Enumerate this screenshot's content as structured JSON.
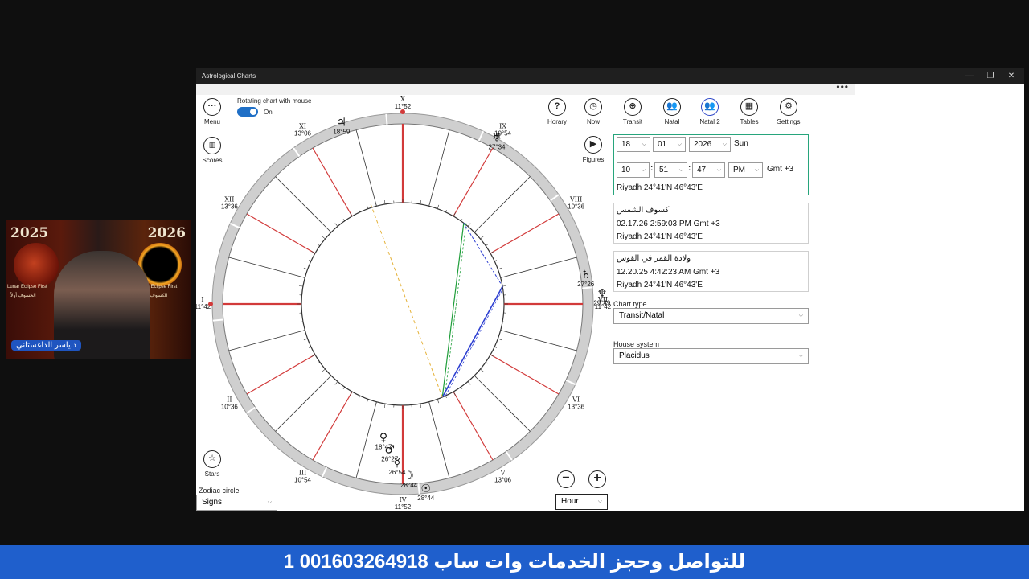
{
  "window": {
    "title": "Astrological Charts",
    "more": "•••",
    "minimize": "—",
    "restore": "❐",
    "close": "✕"
  },
  "left_toolbar": {
    "menu": "Menu",
    "scores": "Scores",
    "stars": "Stars",
    "rotating_label": "Rotating chart with mouse",
    "rotating_state": "On",
    "zodiac_circle_label": "Zodiac circle",
    "zodiac_circle_value": "Signs"
  },
  "top_toolbar": {
    "horary": "Horary",
    "now": "Now",
    "transit": "Transit",
    "natal": "Natal",
    "natal2": "Natal 2",
    "tables": "Tables",
    "settings": "Settings",
    "figures": "Figures"
  },
  "datetime": {
    "day": "18",
    "month": "01",
    "year": "2026",
    "weekday": "Sun",
    "hour": "10",
    "minute": "51",
    "second": "47",
    "ampm": "PM",
    "gmt": "Gmt +3",
    "location": "Riyadh  24°41'N  46°43'E"
  },
  "event1": {
    "title": "كسوف الشمس",
    "datetime": "02.17.26 2:59:03 PM  Gmt +3",
    "location": "Riyadh  24°41'N  46°43'E"
  },
  "event2": {
    "title": "ولادة القمر في القوس",
    "datetime": "12.20.25 4:42:23 AM  Gmt +3",
    "location": "Riyadh  24°41'N  46°43'E"
  },
  "chart_type": {
    "label": "Chart type",
    "value": "Transit/Natal"
  },
  "house_system": {
    "label": "House system",
    "value": "Placidus"
  },
  "step": {
    "minus": "−",
    "plus": "+",
    "unit": "Hour"
  },
  "chart": {
    "houses": [
      {
        "num": "X",
        "deg": "11°52"
      },
      {
        "num": "XI",
        "deg": "13°06"
      },
      {
        "num": "XII",
        "deg": "13°36"
      },
      {
        "num": "I",
        "deg": "11°42"
      },
      {
        "num": "II",
        "deg": "10°36"
      },
      {
        "num": "III",
        "deg": "10°54"
      },
      {
        "num": "IV",
        "deg": "11°52"
      },
      {
        "num": "V",
        "deg": "13°06"
      },
      {
        "num": "VI",
        "deg": "13°36"
      },
      {
        "num": "VII",
        "deg": "11°42"
      },
      {
        "num": "VIII",
        "deg": "10°36"
      },
      {
        "num": "IX",
        "deg": "10°54"
      }
    ],
    "planets": [
      {
        "glyph": "♃",
        "deg": "18°59"
      },
      {
        "glyph": "♅",
        "deg": "27°34"
      },
      {
        "glyph": "♄",
        "deg": "27°26"
      },
      {
        "glyph": "♆",
        "deg": "29°49"
      },
      {
        "glyph": "☉",
        "deg": "28°44"
      },
      {
        "glyph": "☽",
        "deg": "28°44"
      },
      {
        "glyph": "☿",
        "deg": "26°54"
      },
      {
        "glyph": "♂",
        "deg": "26°27"
      },
      {
        "glyph": "♀",
        "deg": "18°47"
      }
    ],
    "retro": "R"
  },
  "webcam": {
    "year_left": "2025",
    "year_right": "2026",
    "caption_left": "Lunar Eclipse First",
    "caption_left_ar": "الخسوف أولاً",
    "caption_right": "Solar Eclipse First",
    "caption_right_ar": "الكسوف أولاً",
    "name": "د.ياسر الداغستاني"
  },
  "banner": "للتواصل وحجز الخدمات وات ساب 001603264918 1",
  "colors": {
    "accent": "#1f6fc6",
    "house_line": "#d23a3a",
    "aspect_green": "#1f9e3a",
    "aspect_blue": "#2d3fd1",
    "banner": "#1f5fcc"
  }
}
